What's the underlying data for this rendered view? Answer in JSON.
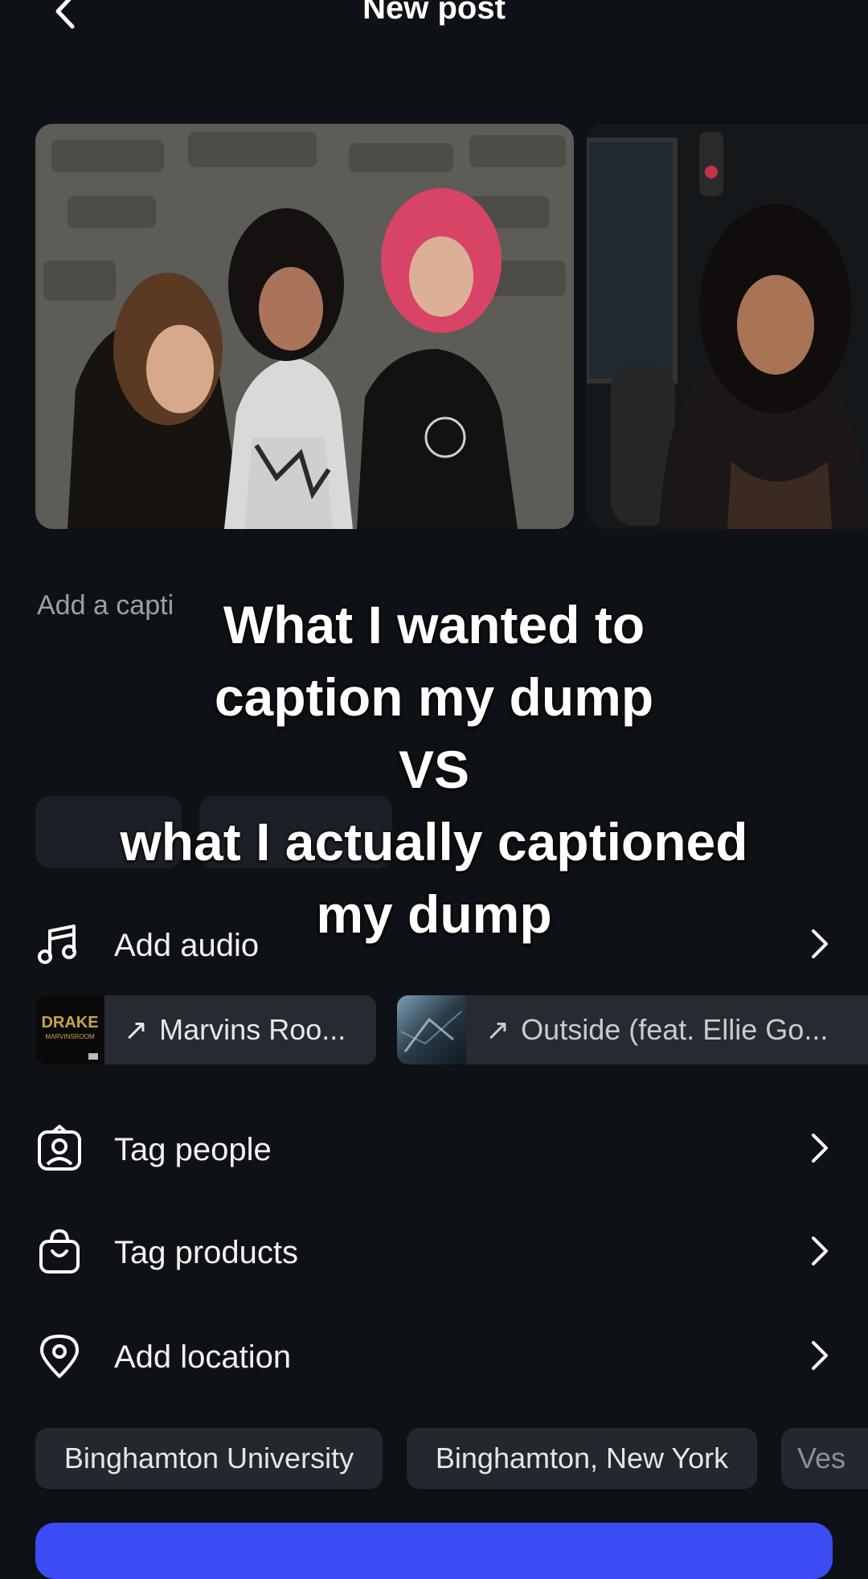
{
  "header": {
    "title": "New post",
    "back_icon": "chevron-left-icon"
  },
  "caption": {
    "placeholder": "Add a capti"
  },
  "overlay": {
    "lines": [
      "What I wanted to",
      "caption my dump",
      "VS",
      "what I actually captioned",
      "my dump"
    ]
  },
  "rows": {
    "audio": {
      "label": "Add audio",
      "icon": "music-note-icon"
    },
    "tag_people": {
      "label": "Tag people",
      "icon": "person-tag-icon"
    },
    "tag_products": {
      "label": "Tag products",
      "icon": "shopping-bag-icon"
    },
    "location": {
      "label": "Add location",
      "icon": "location-pin-icon"
    }
  },
  "audio_suggestions": [
    {
      "title": "Marvins Roo...",
      "arrow": "↗",
      "cover_text": "DRAKE",
      "cover_subtext": "MARVINSROOM"
    },
    {
      "title": "Outside (feat. Ellie Go...",
      "arrow": "↗"
    }
  ],
  "location_suggestions": [
    "Binghamton University",
    "Binghamton, New York",
    "Ves"
  ],
  "colors": {
    "background": "#0e1116",
    "chip": "#262a31",
    "accent": "#3b4cf5"
  }
}
